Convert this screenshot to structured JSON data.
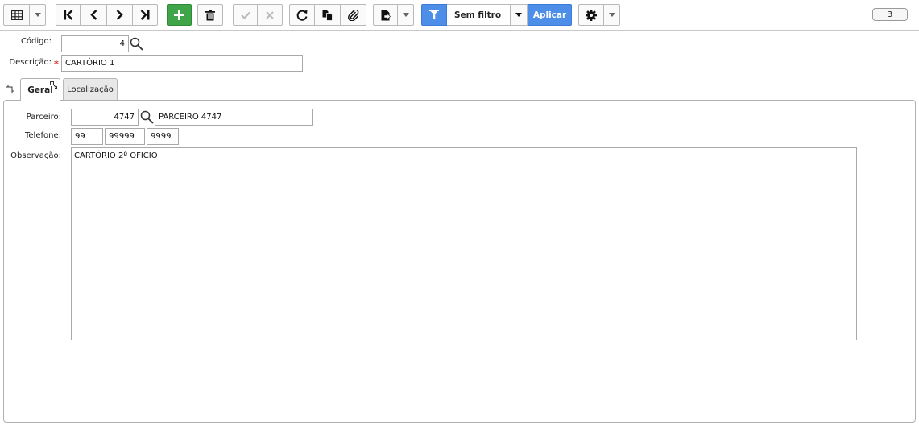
{
  "toolbar": {
    "buttons": [
      {
        "name": "grid-view-icon"
      },
      {
        "name": "first-record-icon"
      },
      {
        "name": "previous-record-icon"
      },
      {
        "name": "next-record-icon"
      },
      {
        "name": "last-record-icon"
      },
      {
        "name": "add-icon"
      },
      {
        "name": "delete-icon"
      },
      {
        "name": "confirm-icon"
      },
      {
        "name": "cancel-icon"
      },
      {
        "name": "refresh-icon"
      },
      {
        "name": "copy-icon"
      },
      {
        "name": "attachment-icon"
      },
      {
        "name": "export-icon"
      },
      {
        "name": "filter-icon"
      },
      {
        "name": "gear-icon"
      }
    ],
    "filter_label": "Sem filtro",
    "apply_label": "Aplicar",
    "page_number": "3",
    "colors": {
      "green": "#3fa548",
      "blue": "#4d8ee9"
    }
  },
  "form": {
    "codigo_label": "Código:",
    "codigo_value": "4",
    "descricao_label": "Descrição:",
    "required_mark": "*",
    "descricao_value": "CARTÓRIO 1"
  },
  "tabs": [
    {
      "label": "Geral",
      "active": true
    },
    {
      "label": "Localização",
      "active": false
    }
  ],
  "geral": {
    "parceiro_label": "Parceiro:",
    "parceiro_code": "4747",
    "parceiro_name": "PARCEIRO 4747",
    "telefone_label": "Telefone:",
    "telefone_ddd": "99",
    "telefone_part1": "99999",
    "telefone_part2": "9999",
    "observacao_label": "Observação:",
    "observacao_value": "CARTÓRIO 2º OFICIO"
  }
}
